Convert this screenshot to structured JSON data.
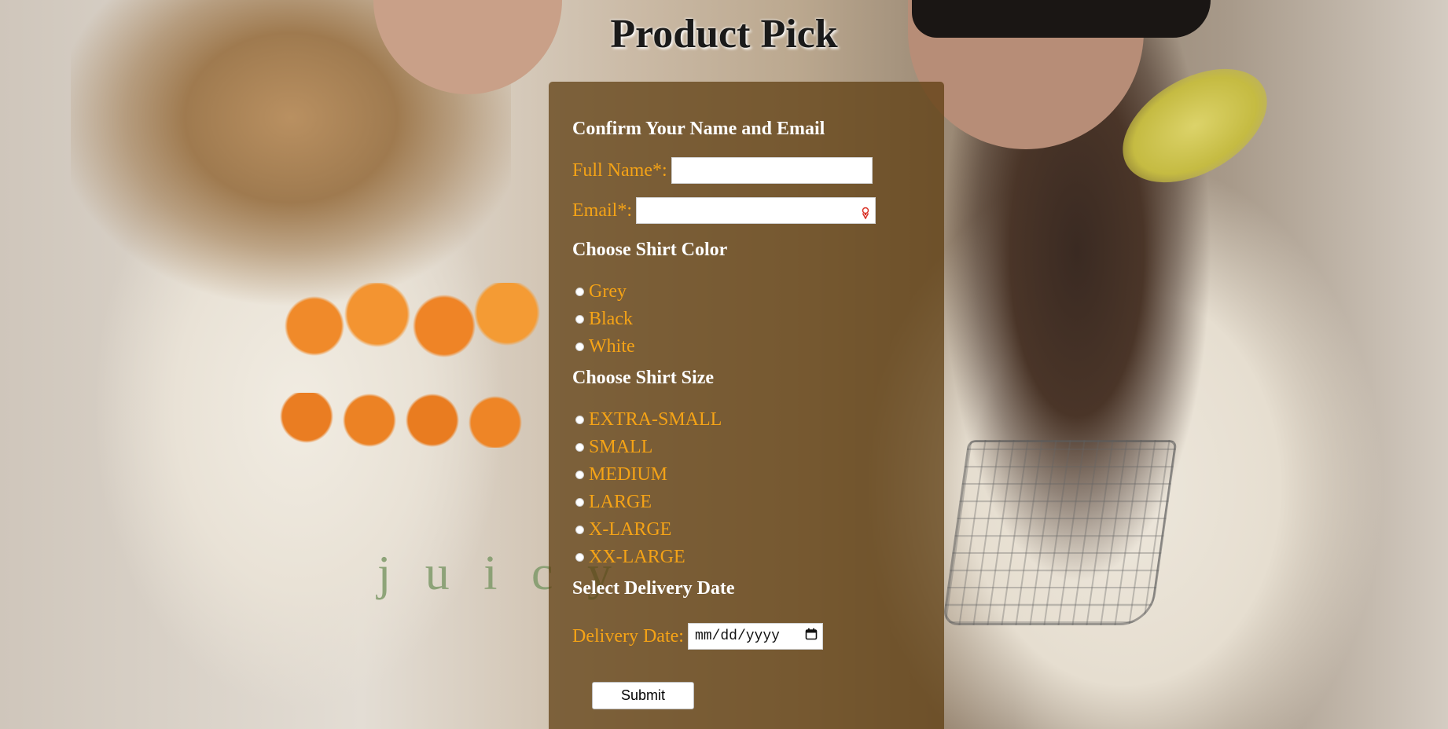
{
  "page": {
    "title": "Product Pick"
  },
  "name_email": {
    "heading": "Confirm Your Name and Email",
    "full_name_label": "Full Name*:",
    "full_name_value": "",
    "email_label": "Email*:",
    "email_value": ""
  },
  "color": {
    "heading": "Choose Shirt Color",
    "options": [
      "Grey",
      "Black",
      "White"
    ]
  },
  "size": {
    "heading": "Choose Shirt Size",
    "options": [
      "EXTRA-SMALL",
      "SMALL",
      "MEDIUM",
      "LARGE",
      "X-LARGE",
      "XX-LARGE"
    ]
  },
  "delivery": {
    "heading": "Select Delivery Date",
    "label": "Delivery Date:",
    "placeholder": "mm/dd/yyyy"
  },
  "submit": {
    "label": "Submit"
  },
  "colors": {
    "panel": "#5c3a0c",
    "label_orange": "#f5a316",
    "heading_white": "#ffffff"
  },
  "icons": {
    "email_field": "password-key-icon",
    "date_field": "calendar-icon"
  }
}
